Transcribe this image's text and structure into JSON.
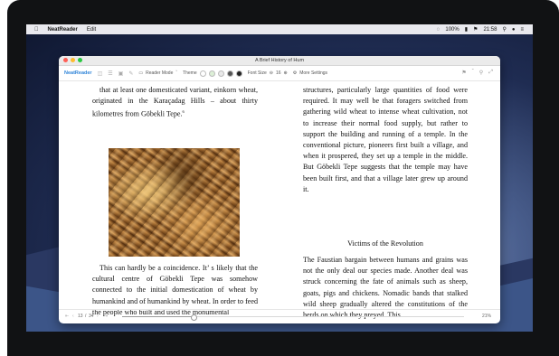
{
  "menubar": {
    "app_name": "NeatReader",
    "edit": "Edit",
    "battery": "100%",
    "time": "21:58"
  },
  "window": {
    "title": "A Brief History of Hum"
  },
  "toolbar": {
    "brand": "NeatReader",
    "reader_mode": "Reader Mode",
    "theme": "Theme",
    "theme_colors": [
      "#ffffff",
      "#dcefd6",
      "#e9e9e9",
      "#555555",
      "#222222"
    ],
    "font_size_label": "Font Size",
    "font_size_value": "16",
    "more_settings": "More Settings"
  },
  "book": {
    "left_top": "that at least one domesticated variant, einkorn wheat, originated in the Karaçadag Hills – about thirty kilometres from Göbekli Tepe.",
    "footnote": "6",
    "left_bottom": "This can hardly be a coincidence. It’ s likely that the cultural centre of Göbekli Tepe was somehow connected to the initial domestication of wheat by humankind and of humankind by wheat. In order to feed the people who built and used the monumental",
    "right_top": "structures, particularly large quantities of food were required. It may well be that foragers switched from gathering wild wheat to intense wheat cultivation, not to increase their normal food supply, but rather to support the building and running of a temple. In the conventional picture, pioneers first built a village, and when it prospered, they set up a temple in the middle. But Göbekli Tepe suggests that the temple may have been built first, and that a village later grew up around it.",
    "heading": "Victims of the Revolution",
    "right_bottom": "The Faustian bargain between humans and grains was not the only deal our species made. Another deal was struck concerning the fate of animals such as sheep, goats, pigs and chickens. Nomadic bands that stalked wild sheep gradually altered the constitutions of the herds on which they preyed. This"
  },
  "footer": {
    "current_page": "13",
    "separator": "/",
    "total_pages": "34",
    "progress_pct": "21%",
    "progress_fraction": 0.21
  }
}
